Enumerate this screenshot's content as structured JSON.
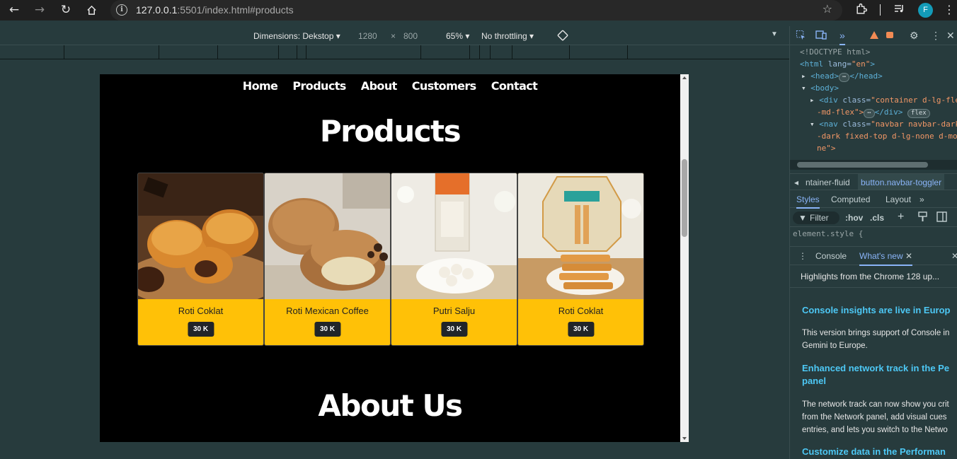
{
  "browser": {
    "url_host": "127.0.0.1",
    "url_rest": ":5501/index.html#products",
    "profile_initial": "F"
  },
  "device_toolbar": {
    "dimensions_label": "Dimensions: Dekstop",
    "width": "1280",
    "times": "×",
    "height": "800",
    "zoom": "65%",
    "throttling": "No throttling"
  },
  "site": {
    "nav": [
      "Home",
      "Products",
      "About",
      "Customers",
      "Contact"
    ],
    "products_heading": "Products",
    "about_heading": "About Us",
    "products": [
      {
        "name": "Roti Coklat",
        "price": "30 K"
      },
      {
        "name": "Roti Mexican Coffee",
        "price": "30 K"
      },
      {
        "name": "Putri Salju",
        "price": "30 K"
      },
      {
        "name": "Roti Coklat",
        "price": "30 K"
      }
    ]
  },
  "devtools": {
    "code": {
      "doctype": "<!DOCTYPE html>",
      "html_open": "<html",
      "lang_attr": "lang=",
      "lang_val": "\"en\"",
      "head": "<head>",
      "head_close": "</head>",
      "body": "<body>",
      "div_open": "<div",
      "class_attr": "class=",
      "div_class_1": "\"container d-lg-fle",
      "div_class_2": "-md-flex\">",
      "div_close": "</div>",
      "flex_pill": "flex",
      "nav_open": "<nav",
      "nav_class_1": "\"navbar navbar-dark",
      "nav_class_2": "-dark fixed-top d-lg-none d-mo",
      "nav_class_3": "ne\">"
    },
    "crumbs": [
      "ntainer-fluid",
      "button.navbar-toggler"
    ],
    "style_tabs": [
      "Styles",
      "Computed",
      "Layout"
    ],
    "filter": "Filter",
    "hov": ":hov",
    "cls": ".cls",
    "element_style": "element.style {",
    "drawer_tabs": [
      "Console",
      "What's new"
    ],
    "whats_new": {
      "highlights": "Highlights from the Chrome 128 up...",
      "h1": "Console insights are live in Europ",
      "p1a": "This version brings support of Console in",
      "p1b": "Gemini to Europe.",
      "h2a": "Enhanced network track in the Pe",
      "h2b": "panel",
      "p2a": "The network track can now show you crit",
      "p2b": "from the Network panel, add visual cues",
      "p2c": "entries, and lets you switch to the Netwo",
      "h3": "Customize data in the Performan"
    }
  }
}
